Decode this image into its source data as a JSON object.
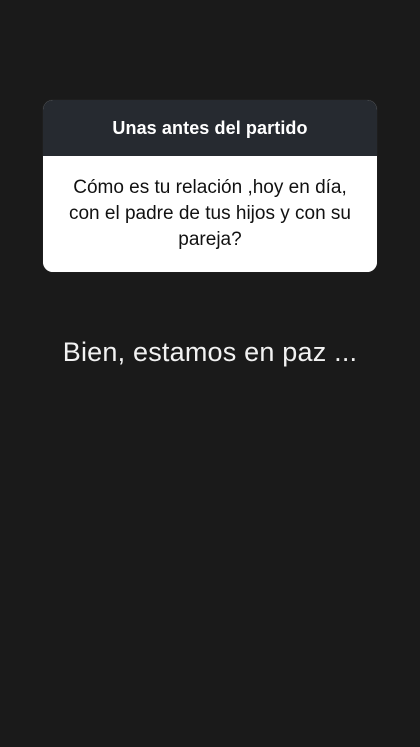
{
  "question_card": {
    "title": "Unas antes del partido",
    "question_line_1": "Cómo es tu relación ,hoy en día,",
    "question_line_2": "con el padre de tus hijos y con su",
    "question_line_3": "pareja?"
  },
  "answer": {
    "text": "Bien, estamos en paz ..."
  },
  "colors": {
    "background": "#1a1a1a",
    "header_background": "#262a30",
    "card_background": "#ffffff",
    "title_text": "#ffffff",
    "question_text": "#111111",
    "answer_text": "#f2f2f2"
  }
}
